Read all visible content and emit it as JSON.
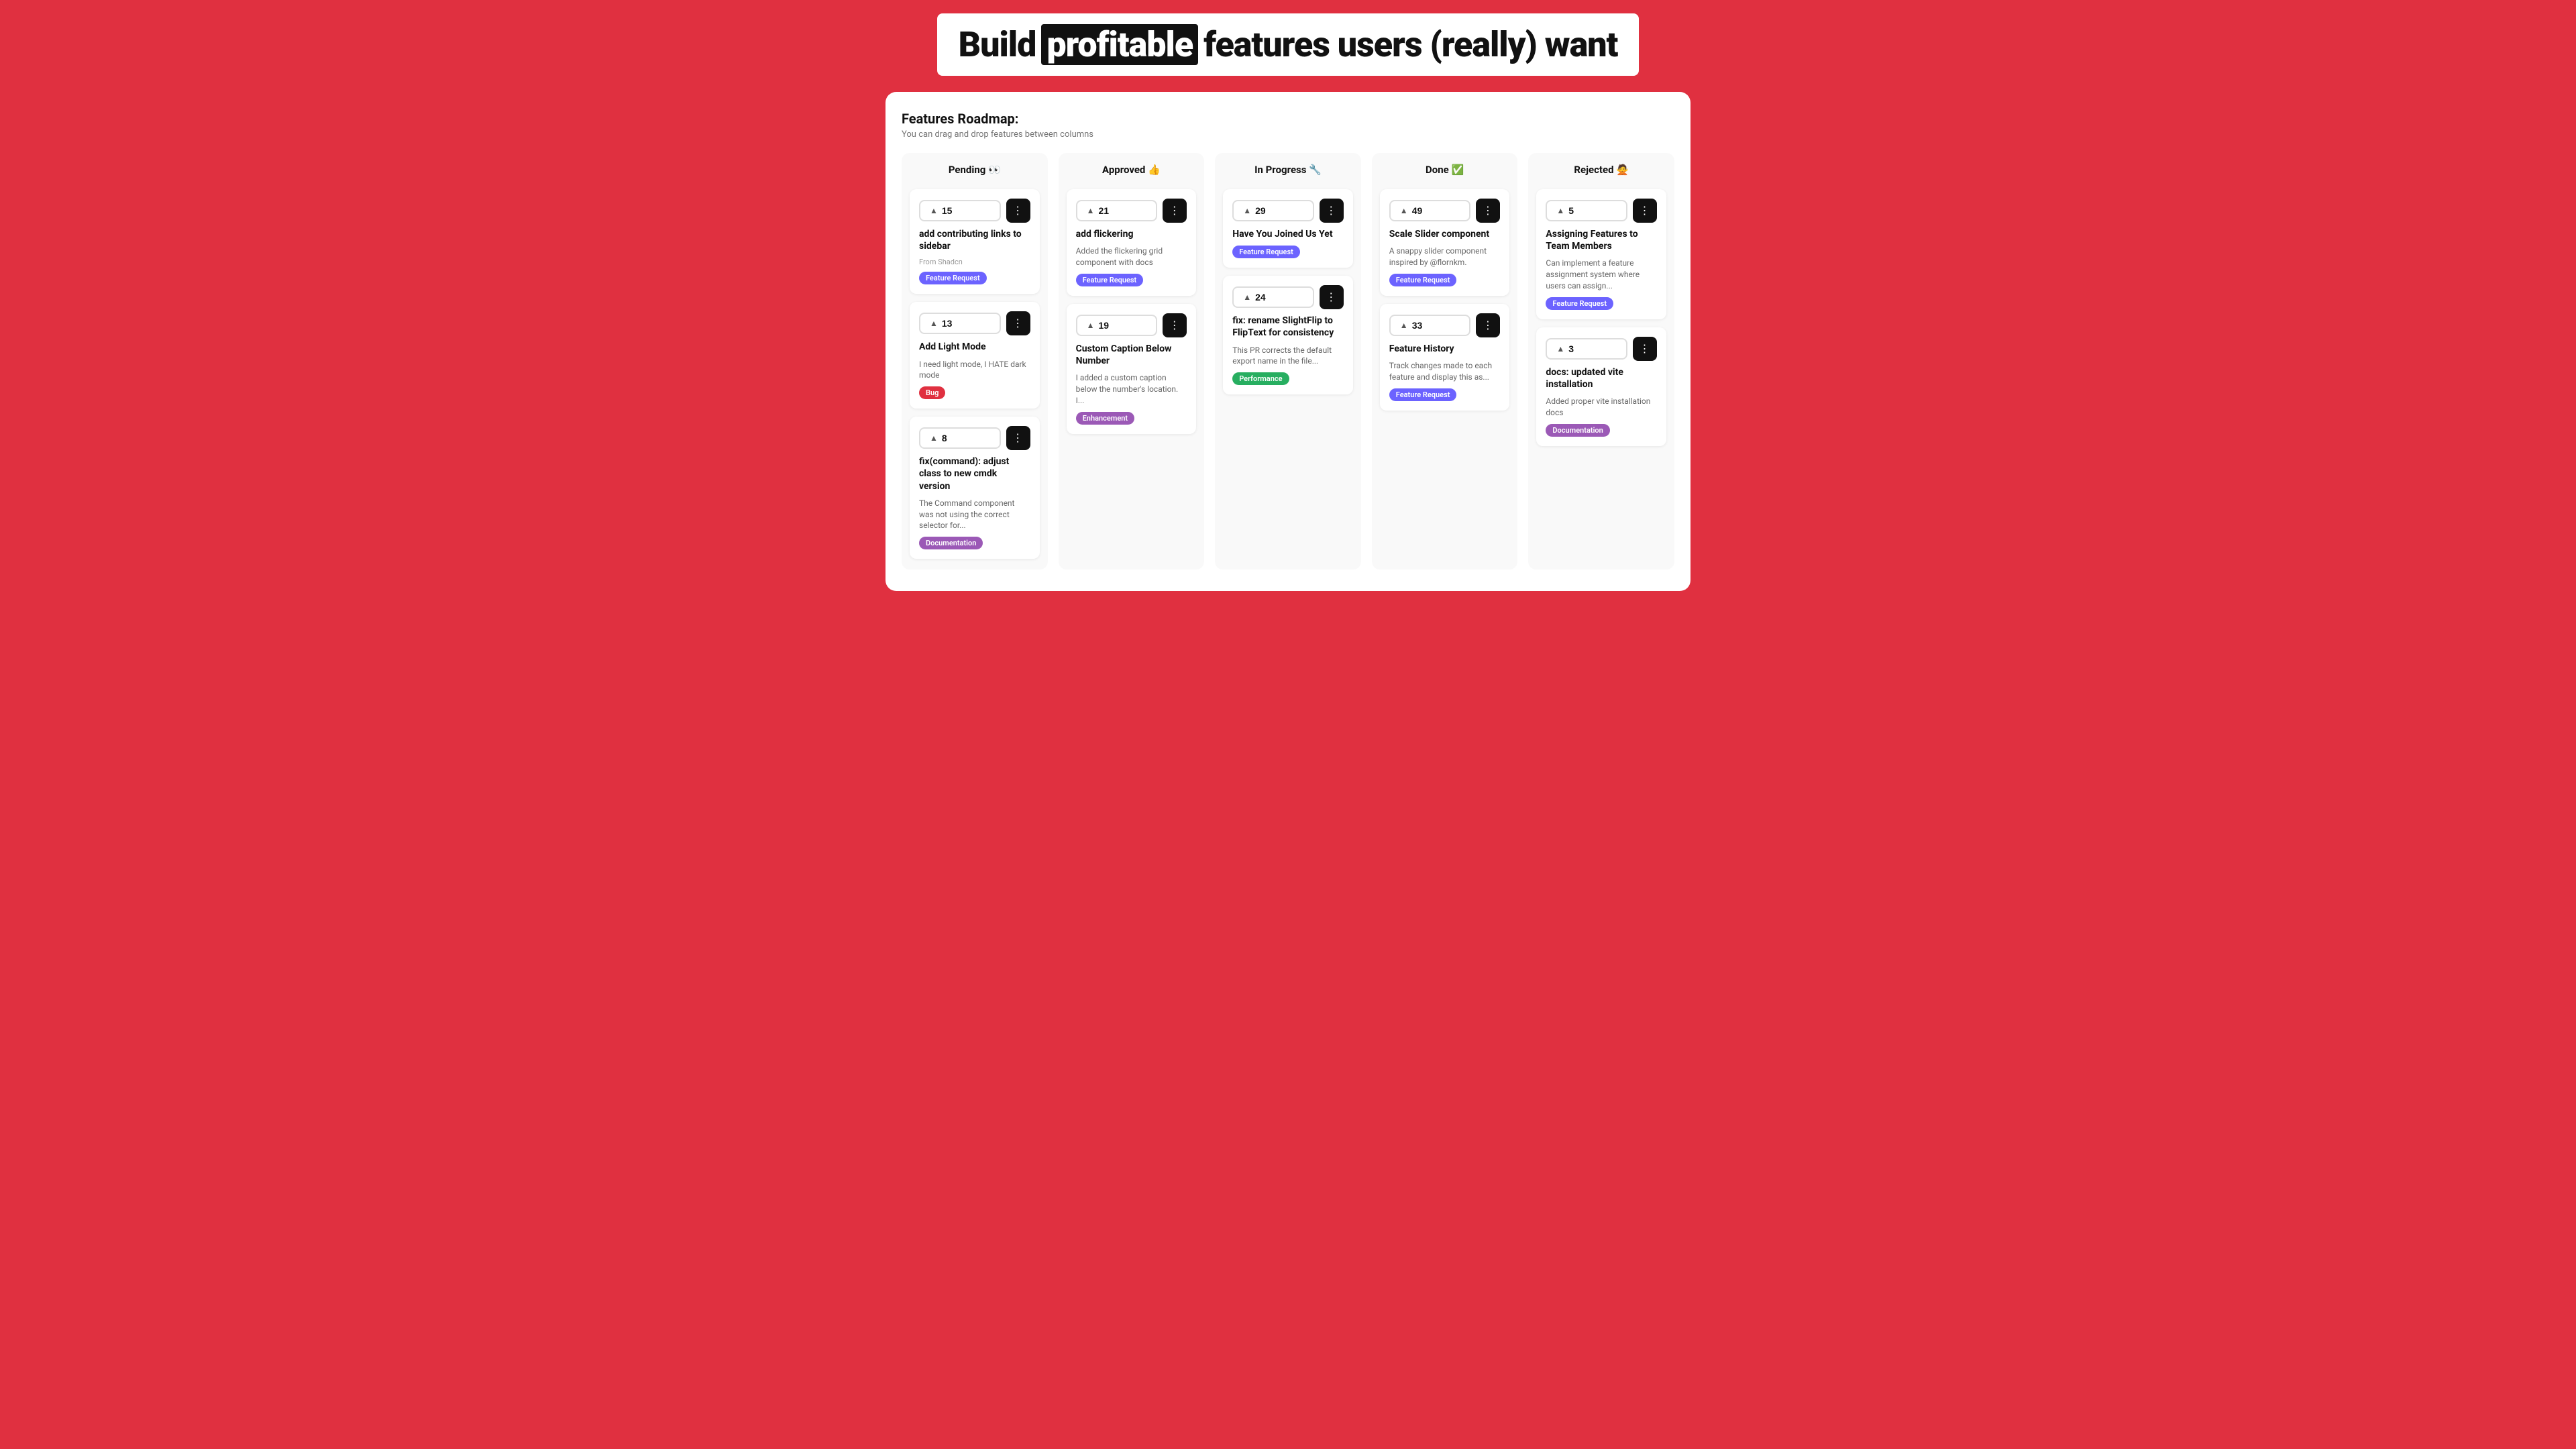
{
  "hero": {
    "word1": "Build",
    "word2": "profitable",
    "word3": "features users (really) want"
  },
  "board": {
    "title": "Features Roadmap:",
    "subtitle": "You can drag and drop features between columns",
    "columns": [
      {
        "id": "pending",
        "label": "Pending 👀",
        "cards": [
          {
            "votes": 15,
            "title": "add contributing links to sidebar",
            "desc": "",
            "source": "From Shadcn",
            "badge": "Feature Request",
            "badge_type": "feature"
          },
          {
            "votes": 13,
            "title": "Add Light Mode",
            "desc": "I need light mode, I HATE dark mode",
            "source": "",
            "badge": "Bug",
            "badge_type": "bug"
          },
          {
            "votes": 8,
            "title": "fix(command): adjust class to new cmdk version",
            "desc": "The Command component was not using the correct selector for...",
            "source": "",
            "badge": "Documentation",
            "badge_type": "documentation"
          }
        ]
      },
      {
        "id": "approved",
        "label": "Approved 👍",
        "cards": [
          {
            "votes": 21,
            "title": "add flickering",
            "desc": "Added the flickering grid component with docs",
            "source": "",
            "badge": "Feature Request",
            "badge_type": "feature"
          },
          {
            "votes": 19,
            "title": "Custom Caption Below Number",
            "desc": "I added a custom caption below the number's location. I...",
            "source": "",
            "badge": "Enhancement",
            "badge_type": "enhancement"
          }
        ]
      },
      {
        "id": "in-progress",
        "label": "In Progress 🔧",
        "cards": [
          {
            "votes": 29,
            "title": "Have You Joined Us Yet",
            "desc": "",
            "source": "",
            "badge": "Feature Request",
            "badge_type": "feature"
          },
          {
            "votes": 24,
            "title": "fix: rename SlightFlip to FlipText for consistency",
            "desc": "This PR corrects the default export name in the file...",
            "source": "",
            "badge": "Performance",
            "badge_type": "performance"
          }
        ]
      },
      {
        "id": "done",
        "label": "Done ✅",
        "cards": [
          {
            "votes": 49,
            "title": "Scale Slider component",
            "desc": "A snappy slider component inspired by @flornkm.",
            "source": "",
            "badge": "Feature Request",
            "badge_type": "feature"
          },
          {
            "votes": 33,
            "title": "Feature History",
            "desc": "Track changes made to each feature and display this as...",
            "source": "",
            "badge": "Feature Request",
            "badge_type": "feature"
          }
        ]
      },
      {
        "id": "rejected",
        "label": "Rejected 🙅",
        "cards": [
          {
            "votes": 5,
            "title": "Assigning Features to Team Members",
            "desc": "Can implement a feature assignment system where users can assign...",
            "source": "",
            "badge": "Feature Request",
            "badge_type": "feature"
          },
          {
            "votes": 3,
            "title": "docs: updated vite installation",
            "desc": "Added proper vite installation docs",
            "source": "",
            "badge": "Documentation",
            "badge_type": "documentation"
          }
        ]
      }
    ]
  }
}
